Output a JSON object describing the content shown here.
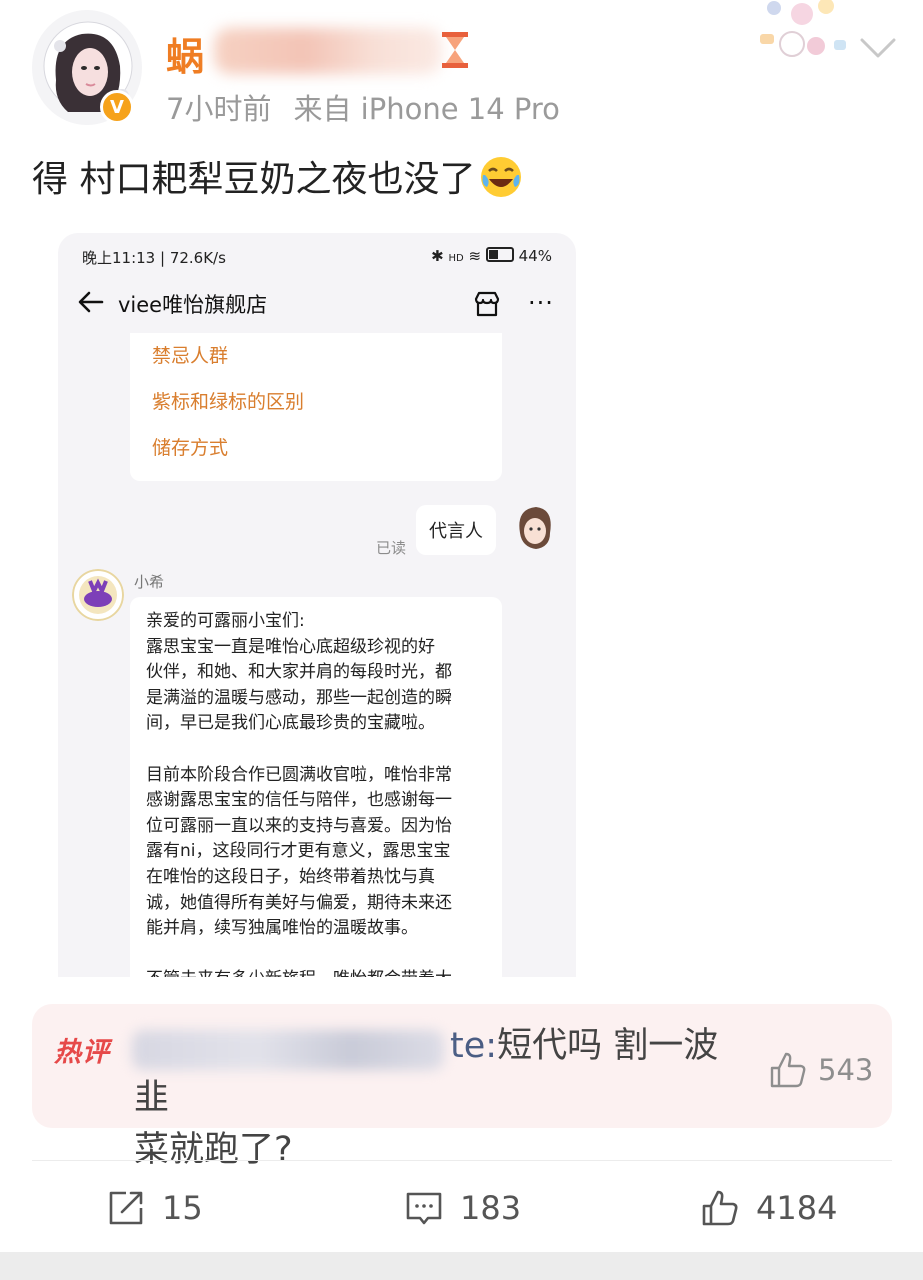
{
  "post": {
    "username_visible": "蜗",
    "time": "7小时前",
    "source": "来自 iPhone 14 Pro",
    "text": "得 村口耙犁豆奶之夜也没了",
    "emoji": "laughing-tears-emoji"
  },
  "screenshot": {
    "status_left": "晚上11:13 | 72.6K/s",
    "status_battery": "44%",
    "status_hd": "HD",
    "nav_title": "viee唯怡旗舰店",
    "nav_more": "···",
    "menu_items": [
      "禁忌人群",
      "紫标和绿标的区别",
      "储存方式"
    ],
    "my_message": "代言人",
    "read_label": "已读",
    "bot_name": "小希",
    "bot_message_lines": [
      "亲爱的可露丽小宝们:",
      "露思宝宝一直是唯怡心底超级珍视的好",
      "伙伴，和她、和大家并肩的每段时光，都",
      "是满溢的温暖与感动，那些一起创造的瞬",
      "间，早已是我们心底最珍贵的宝藏啦。",
      "",
      "目前本阶段合作已圆满收官啦，唯怡非常",
      "感谢露思宝宝的信任与陪伴，也感谢每一",
      "位可露丽一直以来的支持与喜爱。因为怡",
      "露有ni，这段同行才更有意义，露思宝宝",
      "在唯怡的这段日子，始终带着热忱与真",
      "诚，她值得所有美好与偏爱，期待未来还",
      "能并肩，续写独属唯怡的温暖故事。",
      "",
      "不管未来有多少新旅程，唯怡都会带着大"
    ]
  },
  "hot_comment": {
    "badge": "热评",
    "visible_name_tail": "te",
    "text_line1": "短代吗 割一波韭",
    "text_line2": "菜就跑了?",
    "likes": "543"
  },
  "actions": {
    "repost": "15",
    "comments": "183",
    "likes": "4184"
  },
  "colors": {
    "username": "#ef7d23",
    "hot_badge": "#e64949",
    "menu_link": "#d97e2e"
  }
}
